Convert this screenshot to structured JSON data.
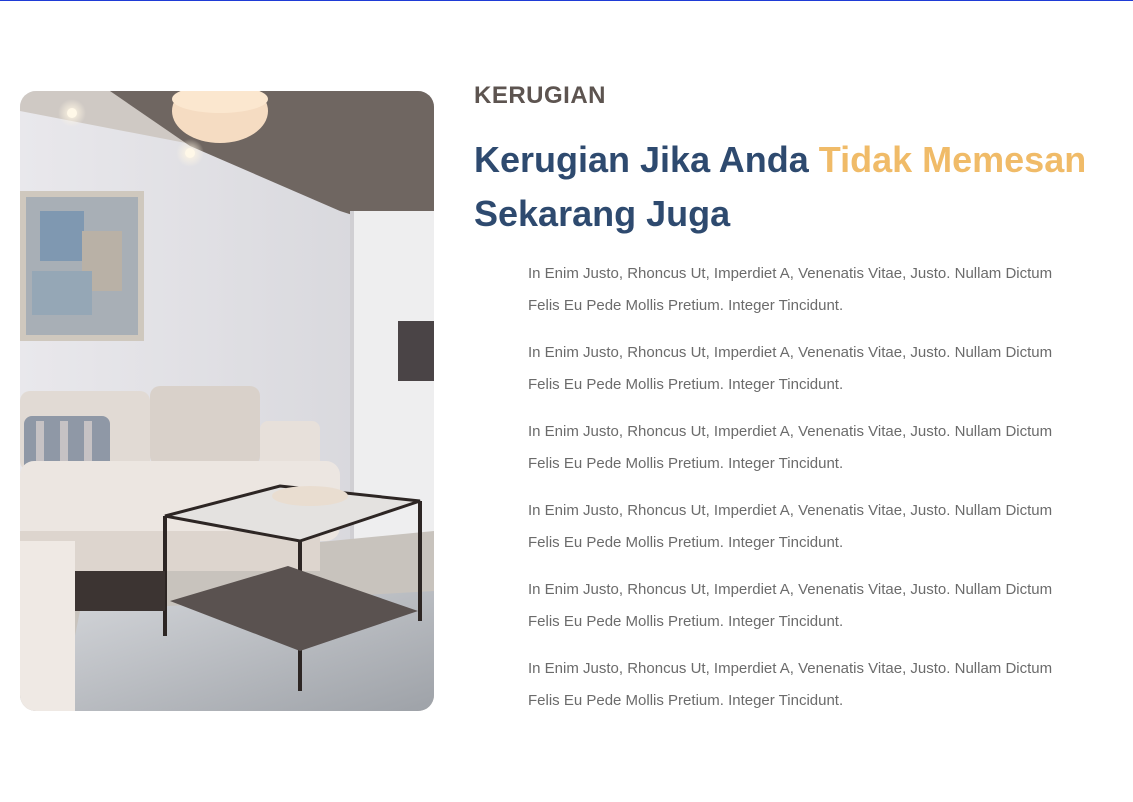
{
  "section": {
    "eyebrow": "KERUGIAN",
    "headline": {
      "part1": "Kerugian Jika Anda ",
      "accent": "Tidak Memesan",
      "part2": "Sekarang Juga"
    },
    "points": [
      {
        "line1": "In Enim Justo, Rhoncus Ut, Imperdiet A, Venenatis Vitae, Justo. Nullam Dictum",
        "line2": "Felis Eu Pede Mollis Pretium. Integer Tincidunt."
      },
      {
        "line1": "In Enim Justo, Rhoncus Ut, Imperdiet A, Venenatis Vitae, Justo. Nullam Dictum",
        "line2": "Felis Eu Pede Mollis Pretium. Integer Tincidunt."
      },
      {
        "line1": "In Enim Justo, Rhoncus Ut, Imperdiet A, Venenatis Vitae, Justo. Nullam Dictum",
        "line2": "Felis Eu Pede Mollis Pretium. Integer Tincidunt."
      },
      {
        "line1": "In Enim Justo, Rhoncus Ut, Imperdiet A, Venenatis Vitae, Justo. Nullam Dictum",
        "line2": "Felis Eu Pede Mollis Pretium. Integer Tincidunt."
      },
      {
        "line1": "In Enim Justo, Rhoncus Ut, Imperdiet A, Venenatis Vitae, Justo. Nullam Dictum",
        "line2": "Felis Eu Pede Mollis Pretium. Integer Tincidunt."
      },
      {
        "line1": "In Enim Justo, Rhoncus Ut, Imperdiet A, Venenatis Vitae, Justo. Nullam Dictum",
        "line2": "Felis Eu Pede Mollis Pretium. Integer Tincidunt."
      }
    ]
  },
  "colors": {
    "eyebrow": "#5d5450",
    "headline": "#2e4a6f",
    "accent": "#f0bb68",
    "body_text": "#6b6b6b",
    "top_border": "#1f3bd6"
  }
}
